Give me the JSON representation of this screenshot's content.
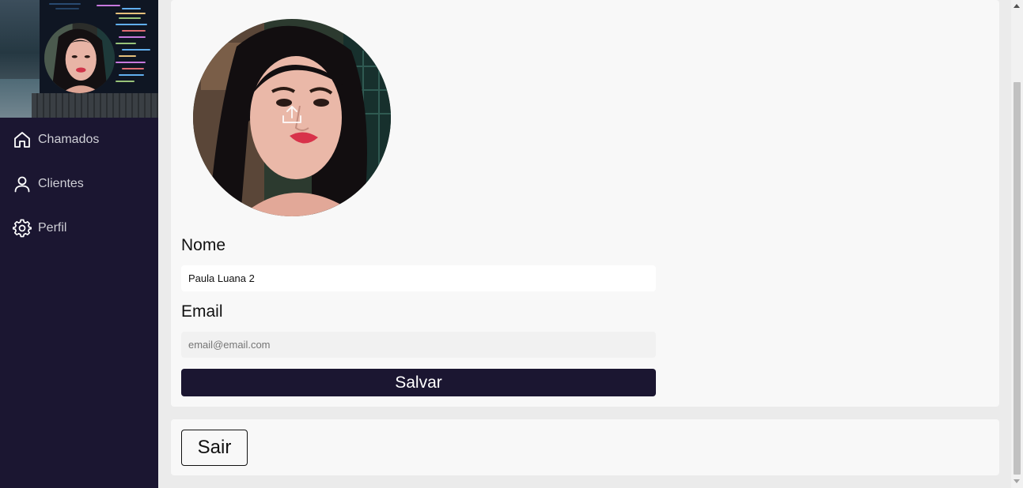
{
  "sidebar": {
    "items": [
      {
        "label": "Chamados",
        "icon": "home-icon"
      },
      {
        "label": "Clientes",
        "icon": "user-icon"
      },
      {
        "label": "Perfil",
        "icon": "gear-icon"
      }
    ]
  },
  "profile": {
    "upload_icon": "upload-icon",
    "name_label": "Nome",
    "name_value": "Paula Luana 2",
    "email_label": "Email",
    "email_placeholder": "email@email.com",
    "save_label": "Salvar"
  },
  "logout": {
    "label": "Sair"
  },
  "colors": {
    "sidebar_bg": "#1b1631",
    "primary_button": "#1b1631",
    "card_bg": "#f8f8f8",
    "page_bg": "#ebebeb"
  }
}
